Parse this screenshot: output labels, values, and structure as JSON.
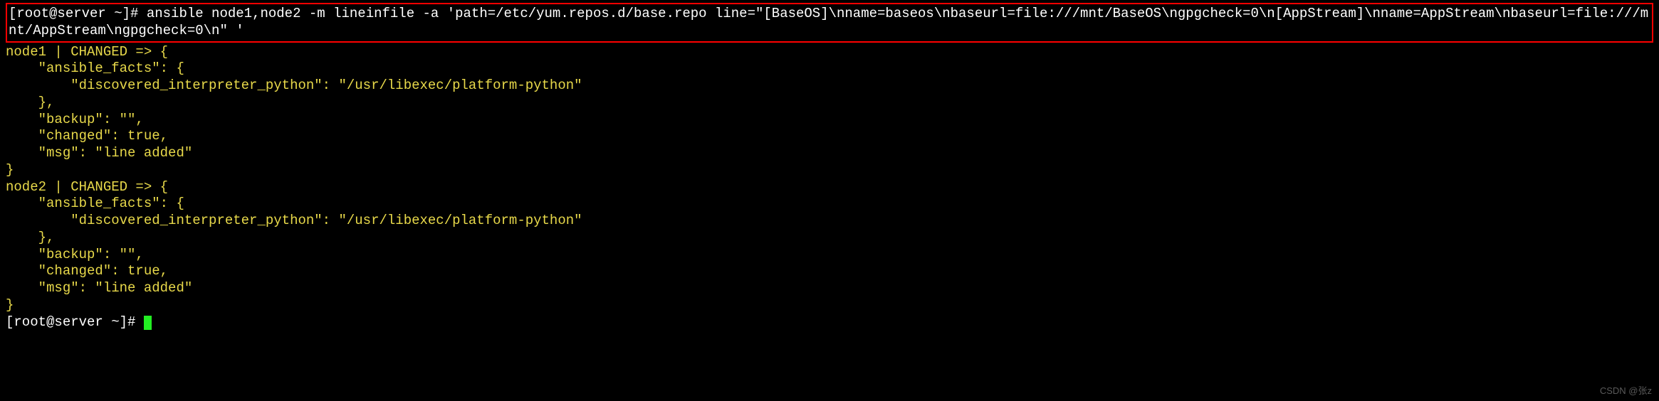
{
  "command": {
    "prompt_prefix": "[root@server ~]# ",
    "text": "ansible node1,node2 -m lineinfile -a 'path=/etc/yum.repos.d/base.repo line=\"[BaseOS]\\nname=baseos\\nbaseurl=file:///mnt/BaseOS\\ngpgcheck=0\\n[AppStream]\\nname=AppStream\\nbaseurl=file:///mnt/AppStream\\ngpgcheck=0\\n\" '"
  },
  "results": [
    {
      "host": "node1",
      "status": "CHANGED",
      "ansible_facts": {
        "discovered_interpreter_python": "/usr/libexec/platform-python"
      },
      "backup": "",
      "changed": true,
      "msg": "line added"
    },
    {
      "host": "node2",
      "status": "CHANGED",
      "ansible_facts": {
        "discovered_interpreter_python": "/usr/libexec/platform-python"
      },
      "backup": "",
      "changed": true,
      "msg": "line added"
    }
  ],
  "final_prompt": {
    "prefix": "[root@server ~]# "
  },
  "formatted": {
    "node1_header": "node1 | CHANGED => {",
    "node2_header": "node2 | CHANGED => {",
    "ansible_facts_open": "    \"ansible_facts\": {",
    "discovered_line": "        \"discovered_interpreter_python\": \"/usr/libexec/platform-python\"",
    "close_facts": "    },",
    "backup_line": "    \"backup\": \"\",",
    "changed_line": "    \"changed\": true,",
    "msg_line": "    \"msg\": \"line added\"",
    "close_obj": "}"
  },
  "watermark": "CSDN @张z"
}
